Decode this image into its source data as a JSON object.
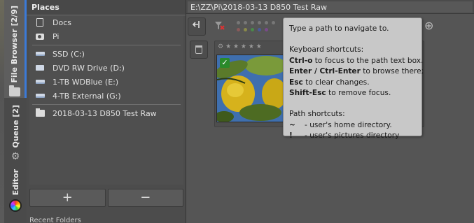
{
  "vertical_tabs": {
    "file_browser": "File Browser [2/9]",
    "queue": "Queue [2]",
    "editor": "Editor"
  },
  "places": {
    "header": "Places",
    "items": [
      {
        "label": "Docs",
        "icon": "document-icon"
      },
      {
        "label": "Pi",
        "icon": "camera-icon"
      },
      {
        "label": "SSD (C:)",
        "icon": "drive-icon"
      },
      {
        "label": "DVD RW Drive (D:)",
        "icon": "dvd-icon"
      },
      {
        "label": "1-TB WDBlue (E:)",
        "icon": "drive-icon"
      },
      {
        "label": "4-TB External (G:)",
        "icon": "drive-icon"
      },
      {
        "label": "2018-03-13 D850 Test Raw",
        "icon": "folder-icon"
      }
    ],
    "add_label": "+",
    "remove_label": "−",
    "recent_label": "Recent Folders"
  },
  "path_bar": {
    "value": "E:\\ZZ\\Pi\\2018-03-13 D850 Test Raw"
  },
  "tooltip": {
    "line1": "Type a path to navigate to.",
    "kb_title": "Keyboard shortcuts:",
    "kb1_key": "Ctrl-o",
    "kb1_text": " to focus to the path text box.",
    "kb2_key": "Enter / Ctrl-Enter",
    "kb2_text": " to browse there;",
    "kb3_key": "Esc",
    "kb3_text": " to clear changes.",
    "kb4_key": "Shift-Esc",
    "kb4_text": " to remove focus.",
    "ps_title": "Path shortcuts:",
    "ps1_key": "~",
    "ps1_text": "- user's home directory.",
    "ps2_key": "!",
    "ps2_text": "- user's pictures directory"
  },
  "colors": {
    "active_tab_accent": "#3b7ad8",
    "check_badge": "#2a8a2a"
  }
}
